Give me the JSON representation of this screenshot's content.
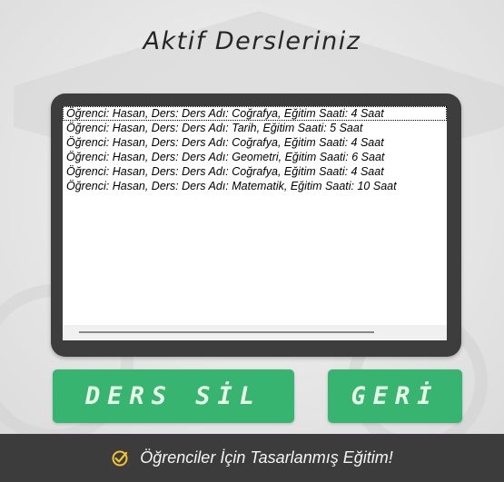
{
  "header": {
    "title": "Aktif Dersleriniz"
  },
  "courses": {
    "items": [
      "Öğrenci: Hasan, Ders: Ders Adı: Coğrafya, Eğitim Saati: 4 Saat",
      "Öğrenci: Hasan, Ders: Ders Adı: Tarih, Eğitim Saati: 5 Saat",
      "Öğrenci: Hasan, Ders: Ders Adı: Coğrafya, Eğitim Saati: 4 Saat",
      "Öğrenci: Hasan, Ders: Ders Adı: Geometri, Eğitim Saati: 6 Saat",
      "Öğrenci: Hasan, Ders: Ders Adı: Coğrafya, Eğitim Saati: 4 Saat",
      "Öğrenci: Hasan, Ders: Ders Adı: Matematik, Eğitim Saati: 10 Saat"
    ],
    "selected_index": 0
  },
  "actions": {
    "delete_label": "DERS SİL",
    "back_label": "GERİ"
  },
  "footer": {
    "text": "Öğrenciler İçin Tasarlanmış Eğitim!",
    "icon": "check-circle-icon"
  },
  "colors": {
    "button": "#37b46f",
    "button_text": "#e8fbe9",
    "frame": "#3d3d3d",
    "footer_bg": "#3c3c3c",
    "footer_icon": "#f2c230"
  }
}
